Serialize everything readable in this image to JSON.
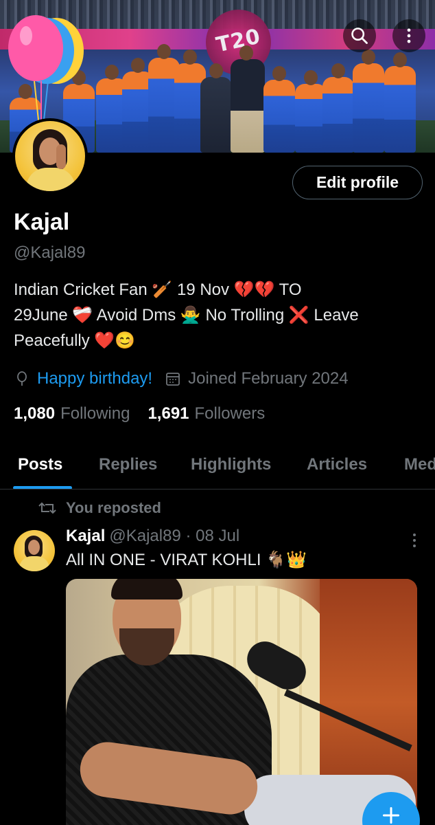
{
  "banner": {
    "t20_text": "T20"
  },
  "header": {
    "search_icon": "search-icon",
    "more_icon": "more-vertical-icon"
  },
  "profile": {
    "edit_label": "Edit profile",
    "name": "Kajal",
    "handle": "@Kajal89",
    "bio_line1": "Indian Cricket Fan 🏏 19 Nov 💔💔 TO",
    "bio_line2": "29June ❤️‍🩹 Avoid Dms 🙅‍♂️ No Trolling ❌ Leave",
    "bio_line3": "Peacefully ❤️😊",
    "birthday": "Happy birthday!",
    "joined": "Joined February 2024",
    "following_count": "1,080",
    "following_label": "Following",
    "followers_count": "1,691",
    "followers_label": "Followers"
  },
  "tabs": [
    {
      "label": "Posts"
    },
    {
      "label": "Replies"
    },
    {
      "label": "Highlights"
    },
    {
      "label": "Articles"
    },
    {
      "label": "Media"
    }
  ],
  "post": {
    "repost_label": "You reposted",
    "author": "Kajal",
    "handle_date": "@Kajal89 · 08 Jul",
    "text": "All IN ONE - VIRAT KOHLI 🐐👑"
  },
  "colors": {
    "accent": "#1d9bf0",
    "background": "#000000",
    "muted": "#71767b"
  }
}
